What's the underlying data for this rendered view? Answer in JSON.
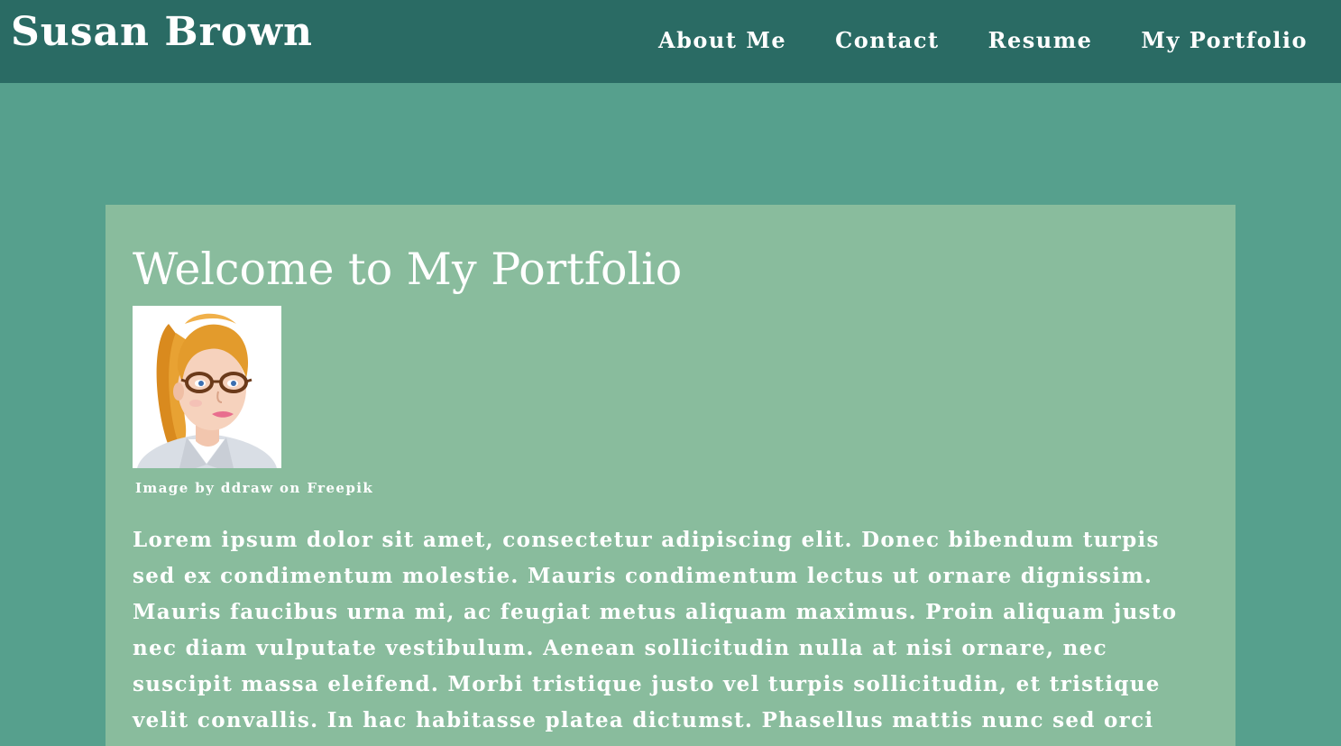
{
  "header": {
    "site_title": "Susan Brown",
    "nav": [
      {
        "label": "About Me"
      },
      {
        "label": "Contact"
      },
      {
        "label": "Resume"
      },
      {
        "label": "My Portfolio"
      }
    ]
  },
  "main": {
    "heading": "Welcome to My Portfolio",
    "image_credit": "Image by ddraw  on Freepik",
    "paragraph": "Lorem ipsum dolor sit amet, consectetur adipiscing elit. Donec bibendum turpis sed ex condimentum molestie. Mauris condimentum lectus ut ornare dignissim. Mauris faucibus urna mi, ac feugiat metus aliquam maximus. Proin aliquam justo nec diam vulputate vestibulum. Aenean sollicitudin nulla at nisi ornare, nec suscipit massa eleifend. Morbi tristique justo vel turpis sollicitudin, et tristique velit convallis. In hac habitasse platea dictumst. Phasellus mattis nunc sed orci"
  },
  "colors": {
    "header_bg": "#2a6b64",
    "page_bg": "#56a08d",
    "panel_bg": "#89bc9d",
    "text": "#ffffff"
  },
  "icons": {
    "portrait": "woman-avatar-illustration"
  }
}
